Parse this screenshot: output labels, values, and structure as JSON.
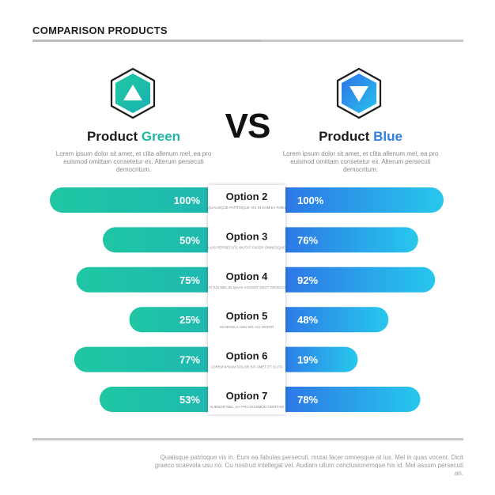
{
  "header": {
    "title": "COMPARISON PRODUCTS"
  },
  "vs_label": "VS",
  "products": {
    "green": {
      "name_prefix": "Product",
      "name_accent": "Green",
      "description": "Lorem ipsum dolor sit  amet, et clita allenum mel, ea pro euismod omittam  consetetur ex. Alterum persecuti democritum.",
      "icon": "triangle-up-icon",
      "color_start": "#1fc6a3",
      "color_end": "#1fb7b2"
    },
    "blue": {
      "name_prefix": "Product",
      "name_accent": "Blue",
      "description": "Lorem ipsum dolor sit  amet, et clita allenum mel, ea pro euismod omittam  consetetur ex. Alterum persecuti democritum.",
      "icon": "triangle-down-icon",
      "color_start": "#2e6fe6",
      "color_end": "#27c8ec"
    }
  },
  "footer": {
    "text": "Qualisque patrioque vis in. Eum ea fabulas persecuti, mutat facer omnesque at ius. Mel in quas vocent. Dicit graeco scaevola usu no. Cu nostrud intellegat vel. Audiam ullum conclusionemque his id. Mel assum persecuti an."
  },
  "chart_data": {
    "type": "bar",
    "title": "",
    "categories": [
      "Option 2",
      "Option 3",
      "Option 4",
      "Option 5",
      "Option 6",
      "Option 7"
    ],
    "category_subtitles": [
      "QUALISQUE PATRIOQUE VIS IN EUM EA FABU",
      "LIUS PERSECUTI, MUTAT FACER OMNESQUE",
      "AT IUS MEL IN QUAS VOCENT DICIT GRAECO",
      "SCAEVOLA USU NO. CU NOSTR",
      "LOREM IPSUM DOLOR SIT  AMET ET CLITA",
      "ALIENUM MEL, EA PRO EUISMOD OMITTAM"
    ],
    "series": [
      {
        "name": "Product Green",
        "values": [
          100,
          50,
          75,
          25,
          77,
          53
        ],
        "labels": [
          "100%",
          "50%",
          "75%",
          "25%",
          "77%",
          "53%"
        ]
      },
      {
        "name": "Product Blue",
        "values": [
          100,
          76,
          92,
          48,
          19,
          78
        ],
        "labels": [
          "100%",
          "76%",
          "92%",
          "48%",
          "19%",
          "78%"
        ]
      }
    ],
    "ylim": [
      0,
      100
    ]
  }
}
